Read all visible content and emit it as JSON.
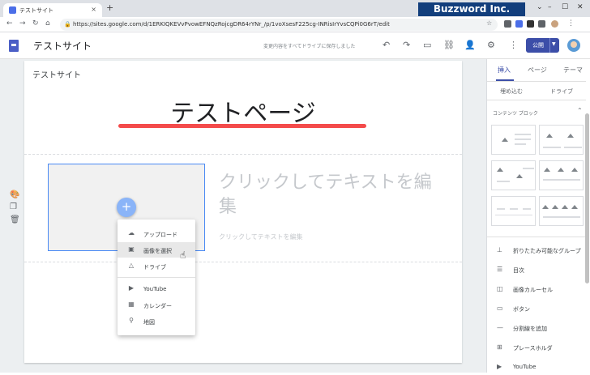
{
  "browser": {
    "tab_title": "テストサイト",
    "tab_close": "×",
    "new_tab": "+",
    "url": "https://sites.google.com/d/1ERKIQKEVvPvowEFNQzRojcgDR64rYNr_/p/1voXsesF225cg-INRisIrYvsCQPi0G6rT/edit",
    "brand": "Buzzword Inc.",
    "brand_color": "#123e7c"
  },
  "app": {
    "site_name": "テストサイト",
    "saved_status": "変更内容をすべてドライブに保存しました",
    "publish_label": "公開",
    "accent_color": "#3c4ea8",
    "toolbar_icons": [
      "undo-icon",
      "redo-icon",
      "preview-icon",
      "link-icon",
      "share-icon",
      "settings-icon",
      "more-icon"
    ]
  },
  "page": {
    "site_label": "テストサイト",
    "title": "テストページ",
    "title_underline_color": "#f44b4b",
    "placeholder_large": "クリックしてテキストを編集",
    "placeholder_small": "クリックしてテキストを編集",
    "add_button": "+"
  },
  "menu": {
    "items": [
      {
        "label": "アップロード",
        "icon": "upload-cloud-icon"
      },
      {
        "label": "画像を選択",
        "icon": "image-icon",
        "highlighted": true
      },
      {
        "label": "ドライブ",
        "icon": "drive-icon"
      },
      {
        "label": "YouTube",
        "icon": "youtube-icon"
      },
      {
        "label": "カレンダー",
        "icon": "calendar-icon"
      },
      {
        "label": "地図",
        "icon": "map-pin-icon"
      }
    ]
  },
  "panel": {
    "tabs": [
      "挿入",
      "ページ",
      "テーマ"
    ],
    "active_tab": "挿入",
    "sub_items": [
      "埋め込む",
      "ドライブ"
    ],
    "content_blocks_label": "コンテンツ ブロック",
    "items": [
      {
        "label": "折りたたみ可能なグループ",
        "icon": "collapsible-icon"
      },
      {
        "label": "目次",
        "icon": "toc-icon"
      },
      {
        "label": "画像カルーセル",
        "icon": "carousel-icon"
      },
      {
        "label": "ボタン",
        "icon": "button-icon"
      },
      {
        "label": "分割線を追加",
        "icon": "divider-icon"
      },
      {
        "label": "プレースホルダ",
        "icon": "placeholder-icon"
      },
      {
        "label": "YouTube",
        "icon": "youtube-icon"
      }
    ]
  }
}
